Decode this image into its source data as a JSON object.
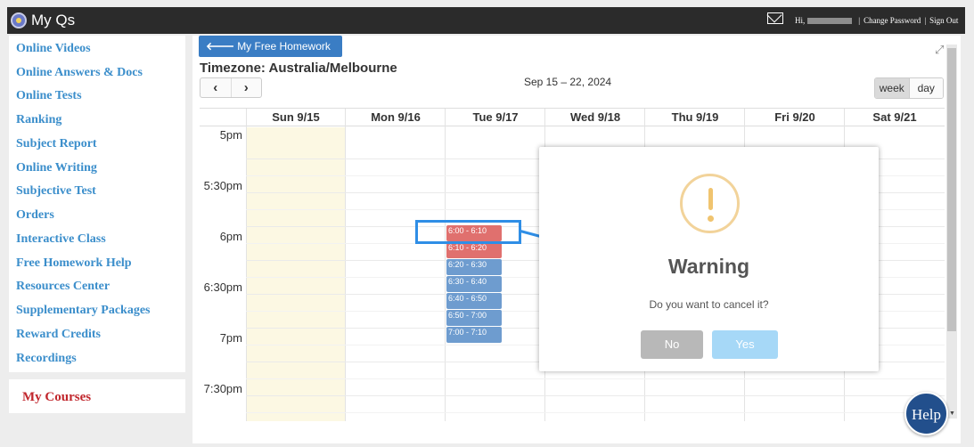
{
  "topbar": {
    "title": "My Qs",
    "greeting": "Hi,",
    "change_password": "Change Password",
    "separator": "|",
    "sign_out": "Sign Out",
    "logo_icon": "globe-logo-icon",
    "mail_icon": "mail-icon"
  },
  "sidebar": {
    "items": [
      {
        "label": "Online Videos"
      },
      {
        "label": "Online Answers & Docs"
      },
      {
        "label": "Online Tests"
      },
      {
        "label": "Ranking"
      },
      {
        "label": "Subject Report"
      },
      {
        "label": "Online Writing"
      },
      {
        "label": "Subjective Test"
      },
      {
        "label": "Orders"
      },
      {
        "label": "Interactive Class"
      },
      {
        "label": "Free Homework Help"
      },
      {
        "label": "Resources Center"
      },
      {
        "label": "Supplementary Packages"
      },
      {
        "label": "Reward Credits"
      },
      {
        "label": "Recordings"
      }
    ],
    "courses_label": "My Courses"
  },
  "main": {
    "back_button": "My Free Homework Help",
    "timezone": "Timezone: Australia/Melbourne",
    "prev": "‹",
    "next": "›",
    "range": "Sep 15 – 22, 2024",
    "view_week": "week",
    "view_day": "day",
    "days": [
      "Sun 9/15",
      "Mon 9/16",
      "Tue 9/17",
      "Wed 9/18",
      "Thu 9/19",
      "Fri 9/20",
      "Sat 9/21"
    ],
    "times": [
      "5pm",
      "5:30pm",
      "6pm",
      "6:30pm",
      "7pm",
      "7:30pm"
    ],
    "events": [
      {
        "label": "6:00 - 6:10",
        "status": "red"
      },
      {
        "label": "6:10 - 6:20",
        "status": "red"
      },
      {
        "label": "6:20 - 6:30",
        "status": "blue"
      },
      {
        "label": "6:30 - 6:40",
        "status": "blue"
      },
      {
        "label": "6:40 - 6:50",
        "status": "blue"
      },
      {
        "label": "6:50 - 7:00",
        "status": "blue"
      },
      {
        "label": "7:00 - 7:10",
        "status": "blue"
      }
    ]
  },
  "modal": {
    "title": "Warning",
    "message": "Do you want to cancel it?",
    "no": "No",
    "yes": "Yes"
  },
  "help": {
    "label": "Help"
  },
  "colors": {
    "accent": "#3a7dc4",
    "link": "#3b8ecb",
    "courses": "#c1272d",
    "event_red": "#e0706e",
    "event_blue": "#6e9ccf",
    "today": "#fcf8e3"
  }
}
